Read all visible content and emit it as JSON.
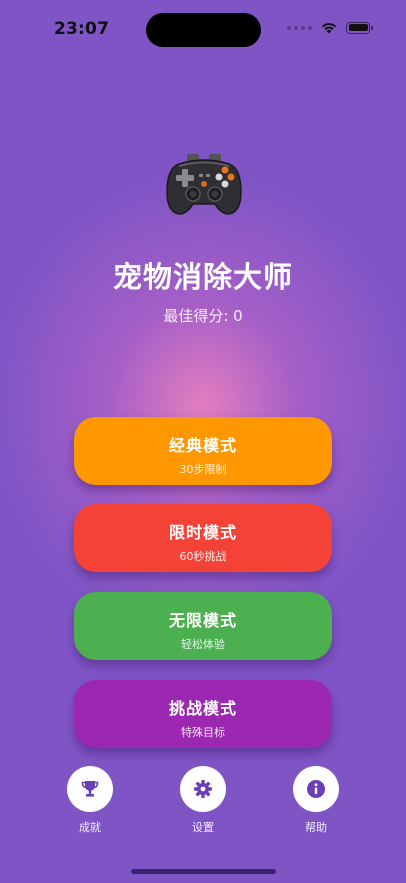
{
  "status_bar": {
    "time": "23:07"
  },
  "header": {
    "icon": "gamepad-icon",
    "title": "宠物消除大师",
    "best_score": "最佳得分: 0"
  },
  "modes": [
    {
      "title": "经典模式",
      "subtitle": "30步限制",
      "color": "#ff9800"
    },
    {
      "title": "限时模式",
      "subtitle": "60秒挑战",
      "color": "#f44336"
    },
    {
      "title": "无限模式",
      "subtitle": "轻松体验",
      "color": "#4caf50"
    },
    {
      "title": "挑战模式",
      "subtitle": "特殊目标",
      "color": "#9c27b0"
    }
  ],
  "bottom_nav": [
    {
      "label": "成就",
      "icon": "trophy-icon"
    },
    {
      "label": "设置",
      "icon": "gear-icon"
    },
    {
      "label": "帮助",
      "icon": "info-icon"
    }
  ],
  "colors": {
    "background": "#7f55c6",
    "icon_accent": "#6a3fb5"
  }
}
